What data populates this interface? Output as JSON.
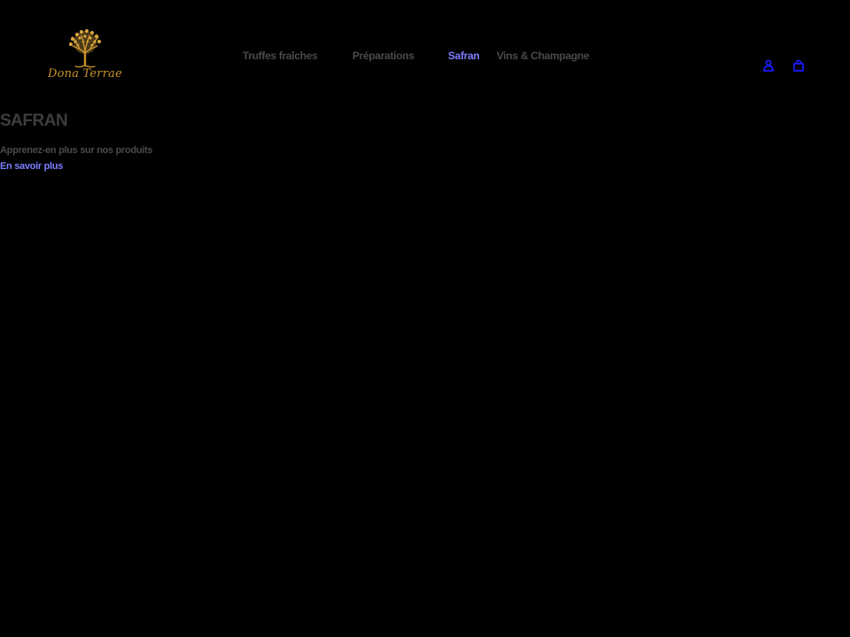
{
  "brand": {
    "name": "Dona Terrae",
    "logo_icon": "golden-tree-icon",
    "logo_color": "#c9922e"
  },
  "nav": {
    "items": [
      {
        "label": "Truffes fraîches",
        "active": false
      },
      {
        "label": "Préparations",
        "active": false
      },
      {
        "label": "Safran",
        "active": true
      },
      {
        "label": "Vins & Champagne",
        "active": false
      }
    ]
  },
  "header_icons": {
    "account": "user-icon",
    "cart": "shopping-bag-icon"
  },
  "main": {
    "title": "SAFRAN",
    "subtitle": "Apprenez-en plus sur nos produits",
    "link_label": "En savoir plus"
  },
  "colors": {
    "background": "#000000",
    "text_muted": "#4a4a4a",
    "accent": "#7b7fff",
    "icon_blue": "#1a1aff"
  }
}
